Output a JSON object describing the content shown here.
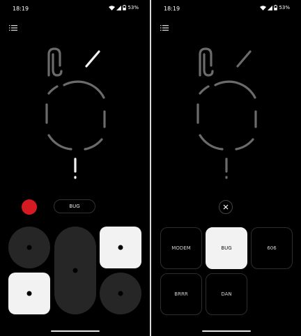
{
  "left": {
    "status": {
      "time": "18:19",
      "battery": "53%"
    },
    "mode_pill": "BUG"
  },
  "right": {
    "status": {
      "time": "18:19",
      "battery": "53%"
    },
    "tiles": [
      "MODEM",
      "BUG",
      "606",
      "BRRR",
      "DAN"
    ],
    "selected_tile": "BUG"
  },
  "colors": {
    "record": "#d71921",
    "lit_pad": "#f2f2f2",
    "pad": "#262626"
  },
  "icons": [
    "menu-icon",
    "wifi-icon",
    "signal-icon",
    "battery-icon",
    "close-icon"
  ]
}
